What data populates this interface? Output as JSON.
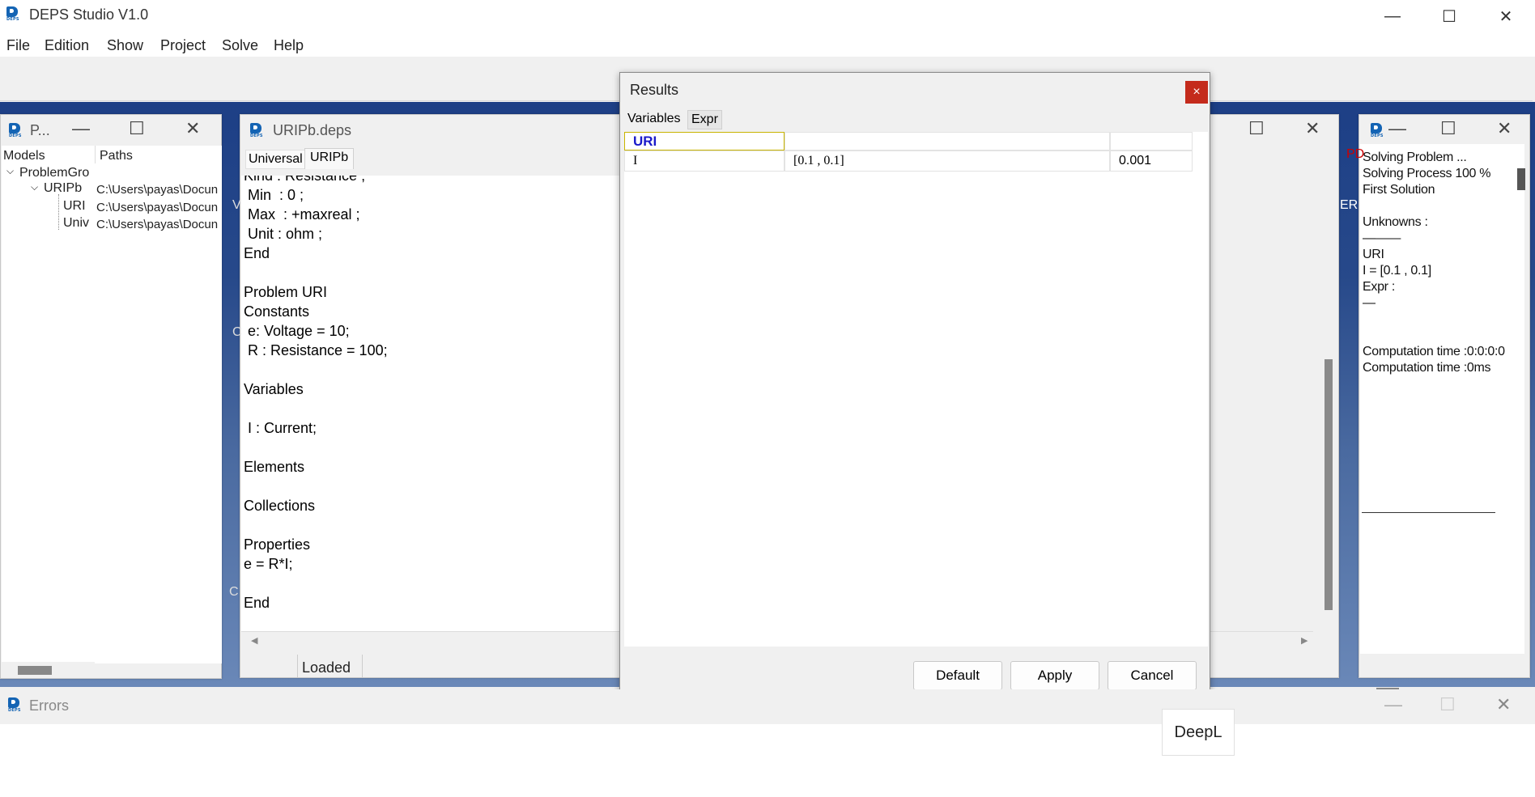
{
  "app": {
    "title": "DEPS Studio V1.0",
    "logo_text": "DEPS",
    "window_controls": {
      "minimize": "—",
      "maximize": "☐",
      "close": "✕"
    }
  },
  "menu": [
    "File",
    "Edition",
    "Show",
    "Project",
    "Solve",
    "Help"
  ],
  "project_window": {
    "title": "P...",
    "columns": [
      "Models",
      "Paths"
    ],
    "tree": [
      {
        "label": "ProblemGro",
        "path": ""
      },
      {
        "label": "URIPb",
        "path": "C:\\Users\\payas\\Docun"
      },
      {
        "label": "URI",
        "path": "C:\\Users\\payas\\Docun"
      },
      {
        "label": "Univ",
        "path": "C:\\Users\\payas\\Docun"
      }
    ]
  },
  "editor_window": {
    "title": "URIPb.deps",
    "tabs": [
      "Universal",
      "URIPb"
    ],
    "status": "Loaded",
    "lines": [
      "Kind : Resistance ;",
      " Min  : 0 ;",
      " Max  : +maxreal ;",
      " Unit : ohm ;",
      "End",
      "",
      "Problem URI",
      "Constants",
      " e: Voltage = 10;",
      " R : Resistance = 100;",
      "",
      "Variables",
      "",
      " I : Current;",
      "",
      "Elements",
      "",
      "Collections",
      "",
      "Properties",
      "e = R*I;",
      "",
      "End"
    ]
  },
  "results_dialog": {
    "title": "Results",
    "close": "×",
    "tabs": [
      "Variables",
      "Expr"
    ],
    "header": {
      "name": "URI",
      "interval": "",
      "precision": ""
    },
    "rows": [
      {
        "name": "I",
        "interval": "[0.1 , 0.1]",
        "precision": "0.001"
      }
    ],
    "buttons": {
      "default": "Default",
      "apply": "Apply",
      "cancel": "Cancel"
    }
  },
  "solve_window": {
    "lines": [
      "Solving Problem ...",
      "Solving Process 100 %",
      "First Solution",
      "",
      "Unknowns :",
      "———",
      " URI",
      " I = [0.1 , 0.1]",
      "Expr :",
      "—",
      "",
      "",
      "Computation time :0:0:0:0",
      "Computation time :0ms"
    ]
  },
  "errors_window": {
    "title": "Errors"
  },
  "deepl": {
    "label": "DeepL"
  },
  "peek_text": {
    "pdf": "PD",
    "er": "ER",
    "c1": "C",
    "c2": "C",
    "v": "V"
  }
}
